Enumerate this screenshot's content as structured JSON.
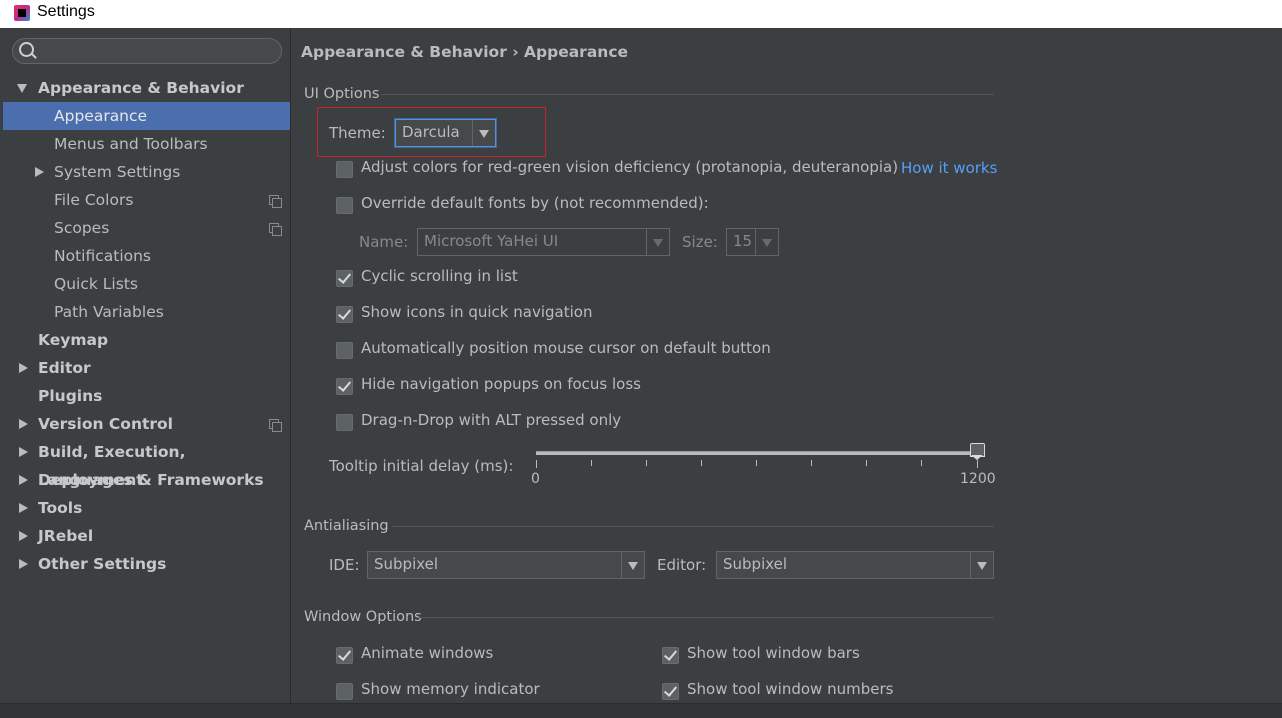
{
  "window": {
    "title": "Settings"
  },
  "search": {
    "placeholder": ""
  },
  "sidebar": {
    "items": [
      {
        "label": "Appearance & Behavior"
      },
      {
        "label": "Appearance"
      },
      {
        "label": "Menus and Toolbars"
      },
      {
        "label": "System Settings"
      },
      {
        "label": "File Colors"
      },
      {
        "label": "Scopes"
      },
      {
        "label": "Notifications"
      },
      {
        "label": "Quick Lists"
      },
      {
        "label": "Path Variables"
      },
      {
        "label": "Keymap"
      },
      {
        "label": "Editor"
      },
      {
        "label": "Plugins"
      },
      {
        "label": "Version Control"
      },
      {
        "label": "Build, Execution, Deployment"
      },
      {
        "label": "Languages & Frameworks"
      },
      {
        "label": "Tools"
      },
      {
        "label": "JRebel"
      },
      {
        "label": "Other Settings"
      }
    ]
  },
  "breadcrumb": "Appearance & Behavior › Appearance",
  "ui_options": {
    "title": "UI Options",
    "theme_label": "Theme:",
    "theme_value": "Darcula",
    "adjust_colors": {
      "label": "Adjust colors for red-green vision deficiency (protanopia, deuteranopia)",
      "checked": false
    },
    "how_it_works": "How it works",
    "override_fonts": {
      "label": "Override default fonts by (not recommended):",
      "checked": false
    },
    "font_name_label": "Name:",
    "font_name_value": "Microsoft YaHei UI",
    "font_size_label": "Size:",
    "font_size_value": "15",
    "cyclic_scrolling": {
      "label": "Cyclic scrolling in list",
      "checked": true
    },
    "show_icons": {
      "label": "Show icons in quick navigation",
      "checked": true
    },
    "auto_position": {
      "label": "Automatically position mouse cursor on default button",
      "checked": false
    },
    "hide_popups": {
      "label": "Hide navigation popups on focus loss",
      "checked": true
    },
    "drag_drop": {
      "label": "Drag-n-Drop with ALT pressed only",
      "checked": false
    },
    "tooltip_label": "Tooltip initial delay (ms):",
    "tooltip_min": "0",
    "tooltip_max": "1200",
    "tooltip_value": 1200
  },
  "antialiasing": {
    "title": "Antialiasing",
    "ide_label": "IDE:",
    "ide_value": "Subpixel",
    "editor_label": "Editor:",
    "editor_value": "Subpixel"
  },
  "window_options": {
    "title": "Window Options",
    "animate_windows": {
      "label": "Animate windows",
      "checked": true
    },
    "show_memory": {
      "label": "Show memory indicator",
      "checked": false
    },
    "tool_window_bars": {
      "label": "Show tool window bars",
      "checked": true
    },
    "tool_window_numbers": {
      "label": "Show tool window numbers",
      "checked": true
    }
  },
  "colors": {
    "background": "#3c3f41",
    "selection": "#4b6eaf",
    "link": "#589df6",
    "highlight_border": "#c8232c"
  }
}
